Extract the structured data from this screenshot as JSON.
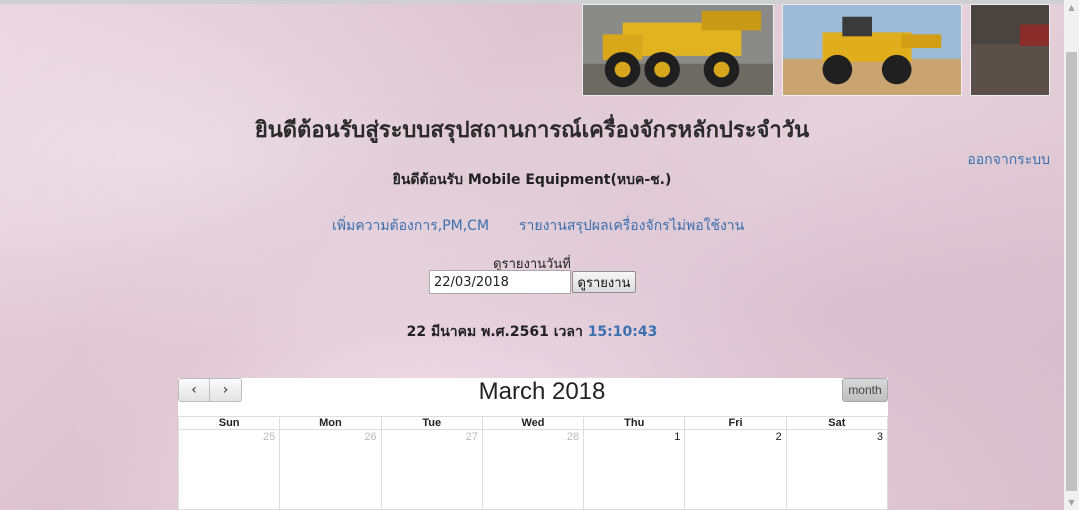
{
  "header": {
    "title": "ยินดีต้อนรับสู่ระบบสรุปสถานการณ์เครื่องจักรหลักประจำวัน",
    "welcome": "ยินดีต้อนรับ Mobile Equipment(หบค-ช.)",
    "logout_label": "ออกจากระบบ"
  },
  "nav": {
    "links": [
      {
        "label": "เพิ่มความต้องการ,PM,CM"
      },
      {
        "label": "รายงานสรุปผลเครื่องจักรไม่พอใช้งาน"
      }
    ]
  },
  "report": {
    "label": "ดูรายงานวันที่",
    "date_value": "22/03/2018",
    "button_label": "ดูรายงาน"
  },
  "datetime": {
    "date_text": "22 มีนาคม พ.ศ.2561 เวลา",
    "time": "15:10:43"
  },
  "calendar": {
    "title": "March 2018",
    "prev_icon": "‹",
    "next_icon": "›",
    "view_button": "month",
    "weekdays": [
      "Sun",
      "Mon",
      "Tue",
      "Wed",
      "Thu",
      "Fri",
      "Sat"
    ],
    "week1": [
      "25",
      "26",
      "27",
      "28",
      "1",
      "2",
      "3"
    ]
  },
  "colors": {
    "link": "#3a6fb0",
    "background": "#e6d0dc"
  }
}
